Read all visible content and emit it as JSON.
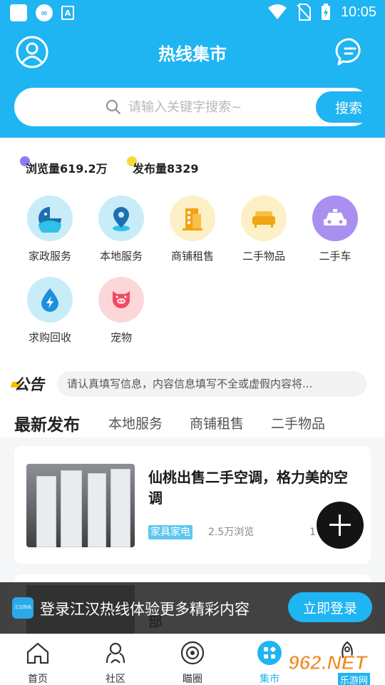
{
  "status_bar": {
    "time": "10:05"
  },
  "header": {
    "title": "热线集市"
  },
  "search": {
    "placeholder": "请输入关键字搜索~",
    "button_label": "搜索"
  },
  "stats": {
    "views": "浏览量619.2万",
    "posts": "发布量8329"
  },
  "categories": [
    {
      "label": "家政服务",
      "icon": "housekeeping-icon",
      "color": "#c9ecf9"
    },
    {
      "label": "本地服务",
      "icon": "location-pin-icon",
      "color": "#c9ecf9"
    },
    {
      "label": "商铺租售",
      "icon": "building-icon",
      "color": "#fdf0c6"
    },
    {
      "label": "二手物品",
      "icon": "sofa-icon",
      "color": "#fdf0c6"
    },
    {
      "label": "二手车",
      "icon": "car-icon",
      "color": "#a990f0"
    },
    {
      "label": "求购回收",
      "icon": "water-drop-icon",
      "color": "#c9ecf9"
    },
    {
      "label": "宠物",
      "icon": "pig-icon",
      "color": "#fcd7d9"
    }
  ],
  "notice": {
    "logo": "公告",
    "text": "请认真填写信息，内容信息填写不全或虚假内容将..."
  },
  "tabs": [
    "最新发布",
    "本地服务",
    "商铺租售",
    "二手物品"
  ],
  "listings": [
    {
      "title": "仙桃出售二手空调，格力美的空调",
      "tag": "家具家电",
      "views": "2.5万浏览",
      "date": "1"
    },
    {
      "title": "部"
    }
  ],
  "login_banner": {
    "logo_text": "江汉热线",
    "text": "登录江汉热线体验更多精彩内容",
    "button": "立即登录"
  },
  "bottom_nav": [
    {
      "label": "首页",
      "icon": "home-icon"
    },
    {
      "label": "社区",
      "icon": "community-icon"
    },
    {
      "label": "瞄圈",
      "icon": "circle-icon"
    },
    {
      "label": "集市",
      "icon": "market-icon",
      "active": true
    },
    {
      "label": "",
      "icon": "rocket-icon"
    }
  ],
  "watermark": {
    "brand": "962.NET",
    "sub": "乐游网"
  },
  "colors": {
    "accent": "#1fb4f2",
    "dark": "#141414"
  }
}
